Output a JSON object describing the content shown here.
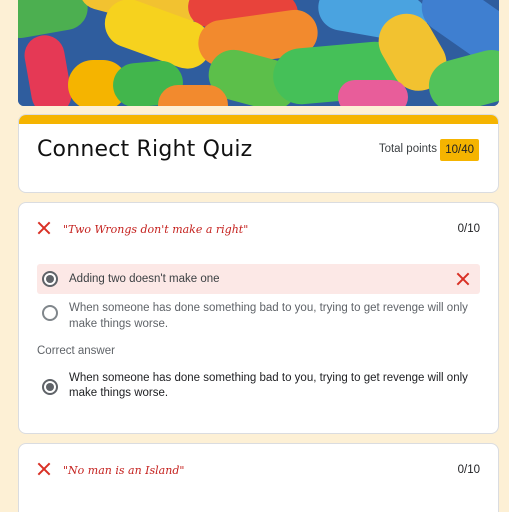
{
  "banner": {
    "icon": "candy-banner-image"
  },
  "header": {
    "title": "Connect Right Quiz",
    "points_label": "Total points",
    "points_value": "10/40",
    "accent": "#f5b400"
  },
  "questions": [
    {
      "title": "\"Two Wrongs don't make a right\"",
      "score": "0/10",
      "options": [
        {
          "label": "Adding two doesn't make one",
          "selected": true,
          "wrong": true
        },
        {
          "label": "When someone has done something bad to you, trying to get revenge will only make things worse.",
          "selected": false
        }
      ],
      "correct_label": "Correct answer",
      "correct_answer": "When someone has done something bad to you, trying to get revenge will only make things worse."
    },
    {
      "title": "\"No man is an Island\"",
      "score": "0/10"
    }
  ],
  "colors": {
    "wrong": "#d93025",
    "wrong_bg": "#fce8e6",
    "page_bg": "#fdf0d5"
  }
}
